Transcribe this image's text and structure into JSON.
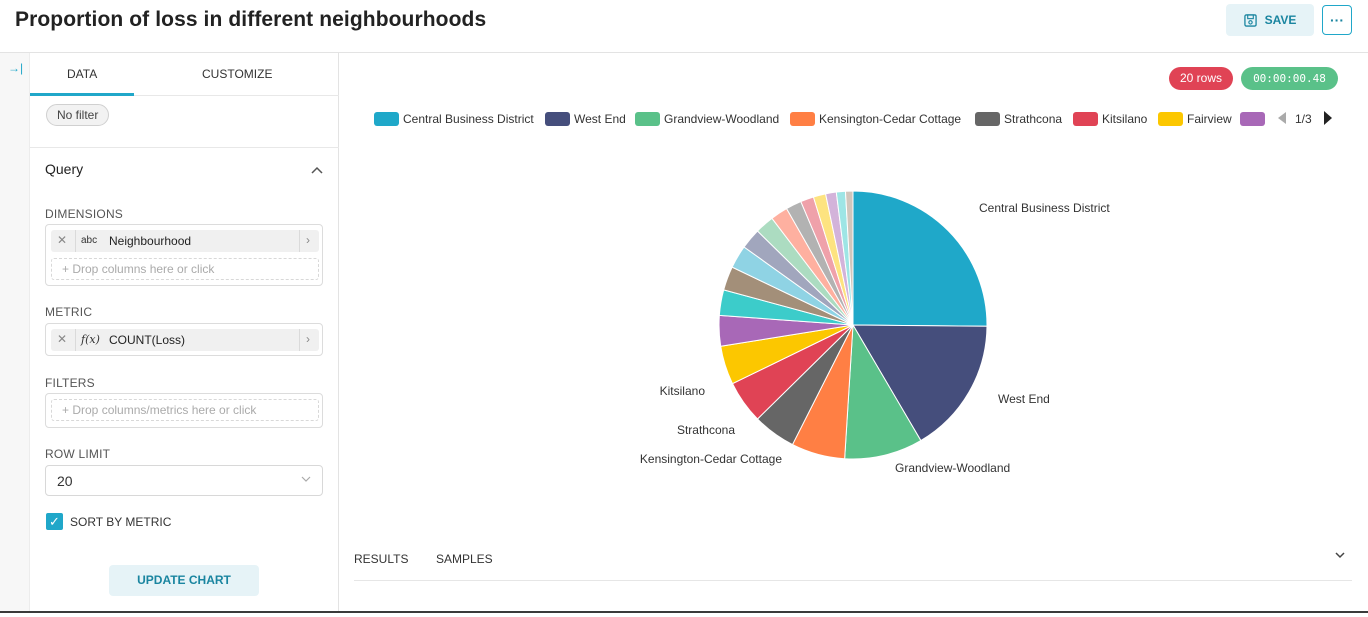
{
  "header": {
    "title": "Proportion of loss in different neighbourhoods",
    "save_label": "SAVE",
    "more_label": "···"
  },
  "rail": {
    "expand_icon": "→|"
  },
  "panel": {
    "tabs": [
      "DATA",
      "CUSTOMIZE"
    ],
    "active_tab": "DATA",
    "filter_chip": "No filter",
    "query": {
      "title": "Query",
      "dimensions_label": "DIMENSIONS",
      "dimension": {
        "type": "abc",
        "name": "Neighbourhood"
      },
      "dimension_drop": "Drop columns here or click",
      "metric_label": "METRIC",
      "metric": {
        "type": "f(x)",
        "name": "COUNT(Loss)"
      },
      "filters_label": "FILTERS",
      "filters_drop": "Drop columns/metrics here or click",
      "row_limit_label": "ROW LIMIT",
      "row_limit": "20",
      "sort_by_metric_label": "SORT BY METRIC",
      "sort_by_metric": true,
      "update_label": "UPDATE CHART"
    }
  },
  "main": {
    "rows_badge": "20 rows",
    "time_badge": "00:00:00.48",
    "legend_page": "1/3",
    "results_tabs": [
      "RESULTS",
      "SAMPLES"
    ]
  },
  "colors": {
    "accent": "#20a7c9",
    "rows_badge": "#e04355",
    "time_badge": "#5ac189"
  },
  "chart_data": {
    "type": "pie",
    "legend_visible": [
      "Central Business District",
      "West End",
      "Grandview-Woodland",
      "Kensington-Cedar Cottage",
      "Strathcona",
      "Kitsilano",
      "Fairview",
      ""
    ],
    "slices": [
      {
        "label": "Central Business District",
        "value": 25.3,
        "color": "#1fa8c9",
        "show_label": true
      },
      {
        "label": "West End",
        "value": 16.5,
        "color": "#454e7c",
        "show_label": true
      },
      {
        "label": "Grandview-Woodland",
        "value": 9.5,
        "color": "#5ac189",
        "show_label": true
      },
      {
        "label": "Kensington-Cedar Cottage",
        "value": 6.5,
        "color": "#ff7f44",
        "show_label": true
      },
      {
        "label": "Strathcona",
        "value": 5.2,
        "color": "#666666",
        "show_label": true
      },
      {
        "label": "Kitsilano",
        "value": 5.2,
        "color": "#e04355",
        "show_label": true
      },
      {
        "label": "",
        "value": 4.7,
        "color": "#fcc700",
        "show_label": false
      },
      {
        "label": "",
        "value": 3.7,
        "color": "#a868b7",
        "show_label": false
      },
      {
        "label": "",
        "value": 3.1,
        "color": "#3cccca",
        "show_label": false
      },
      {
        "label": "",
        "value": 2.9,
        "color": "#a38f79",
        "show_label": false
      },
      {
        "label": "",
        "value": 2.8,
        "color": "#8fd3e4",
        "show_label": false
      },
      {
        "label": "",
        "value": 2.5,
        "color": "#a1a6bd",
        "show_label": false
      },
      {
        "label": "",
        "value": 2.3,
        "color": "#acdcc1",
        "show_label": false
      },
      {
        "label": "",
        "value": 2.1,
        "color": "#feb0a0",
        "show_label": false
      },
      {
        "label": "",
        "value": 1.9,
        "color": "#b2b2b2",
        "show_label": false
      },
      {
        "label": "",
        "value": 1.6,
        "color": "#efa1aa",
        "show_label": false
      },
      {
        "label": "",
        "value": 1.5,
        "color": "#fde380",
        "show_label": false
      },
      {
        "label": "",
        "value": 1.3,
        "color": "#d3b3da",
        "show_label": false
      },
      {
        "label": "",
        "value": 1.1,
        "color": "#9ee5e5",
        "show_label": false
      },
      {
        "label": "",
        "value": 0.9,
        "color": "#d1c6bc",
        "show_label": false
      }
    ]
  }
}
